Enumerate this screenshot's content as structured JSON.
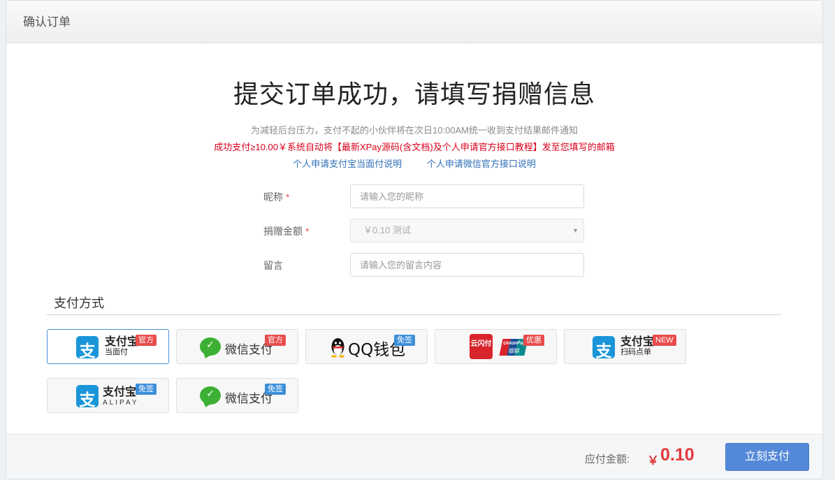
{
  "header": {
    "title": "确认订单"
  },
  "main": {
    "title": "提交订单成功，请填写捐赠信息",
    "notice_gray": "为减轻后台压力，支付不起的小伙伴将在次日10:00AM统一收到支付结果邮件通知",
    "notice_red": "成功支付≥10.00￥系统自动将【最新XPay源码(含文档)及个人申请官方接口教程】发至您填写的邮箱",
    "links": [
      "个人申请支付宝当面付说明",
      "个人申请微信官方接口说明"
    ]
  },
  "form": {
    "nickname": {
      "label": "昵称",
      "required": "*",
      "placeholder": "请输入您的昵称",
      "value": ""
    },
    "amount": {
      "label": "捐赠金额",
      "required": "*",
      "selected": "￥0.10 测试"
    },
    "message": {
      "label": "留言",
      "placeholder": "请输入您的留言内容",
      "value": ""
    }
  },
  "payment": {
    "section_title": "支付方式",
    "options": [
      {
        "brand": "支付宝",
        "sub": "当面付",
        "badge": "官方",
        "badge_color": "#e84d4d",
        "icon": "alipay-icon",
        "selected": true
      },
      {
        "brand": "微信支付",
        "badge": "官方",
        "badge_color": "#e84d4d",
        "icon": "wechat-pay-icon",
        "selected": false
      },
      {
        "brand": "QQ钱包",
        "badge": "免签",
        "badge_color": "#3d8fd9",
        "icon": "qq-penguin-icon",
        "selected": false
      },
      {
        "brand": "云闪付",
        "brand2": "UnionPay",
        "brand3": "银联",
        "badge": "优惠",
        "badge_color": "#e84d4d",
        "icon": "unionpay-icon",
        "selected": false
      },
      {
        "brand": "支付宝",
        "sub": "扫码点单",
        "badge": "NEW",
        "badge_color": "#e84d4d",
        "icon": "alipay-icon",
        "selected": false
      },
      {
        "brand": "支付宝",
        "sub": "ALIPAY",
        "badge": "免签",
        "badge_color": "#3d8fd9",
        "icon": "alipay-icon",
        "selected": false
      },
      {
        "brand": "微信支付",
        "badge": "免签",
        "badge_color": "#3d8fd9",
        "icon": "wechat-pay-icon",
        "selected": false
      }
    ]
  },
  "footer": {
    "total_label": "应付金额:",
    "currency": "￥",
    "total": "0.10",
    "pay_button": "立刻支付"
  },
  "colors": {
    "accent": "#5389d8",
    "price": "#e4393c",
    "notice_red": "#d9001b",
    "link": "#2f6fb8"
  }
}
